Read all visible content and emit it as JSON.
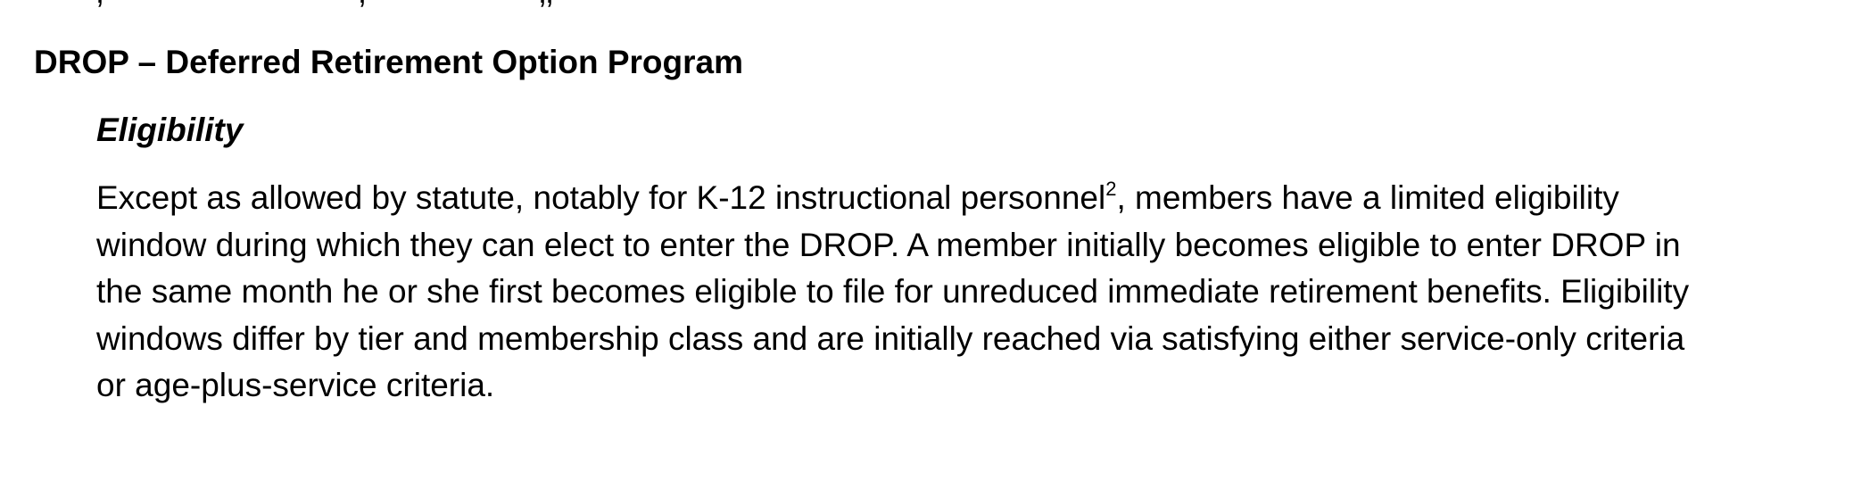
{
  "document": {
    "section_heading": "DROP – Deferred Retirement Option Program",
    "subsection_heading": "Eligibility",
    "paragraph": {
      "line1_before_footnote": "Except as allowed by statute, notably for K-12 instructional personnel",
      "footnote_marker": "2",
      "line1_after_footnote": ", members have a limited eligibility",
      "line2": "window during which they can elect to enter the DROP. A member initially becomes eligible to enter DROP in",
      "line3": "the same month he or she first becomes eligible to file for unreduced immediate retirement benefits. Eligibility",
      "line4": "windows differ by tier and membership class and are initially reached via satisfying either service-only criteria",
      "line5": "or age-plus-service criteria."
    }
  }
}
